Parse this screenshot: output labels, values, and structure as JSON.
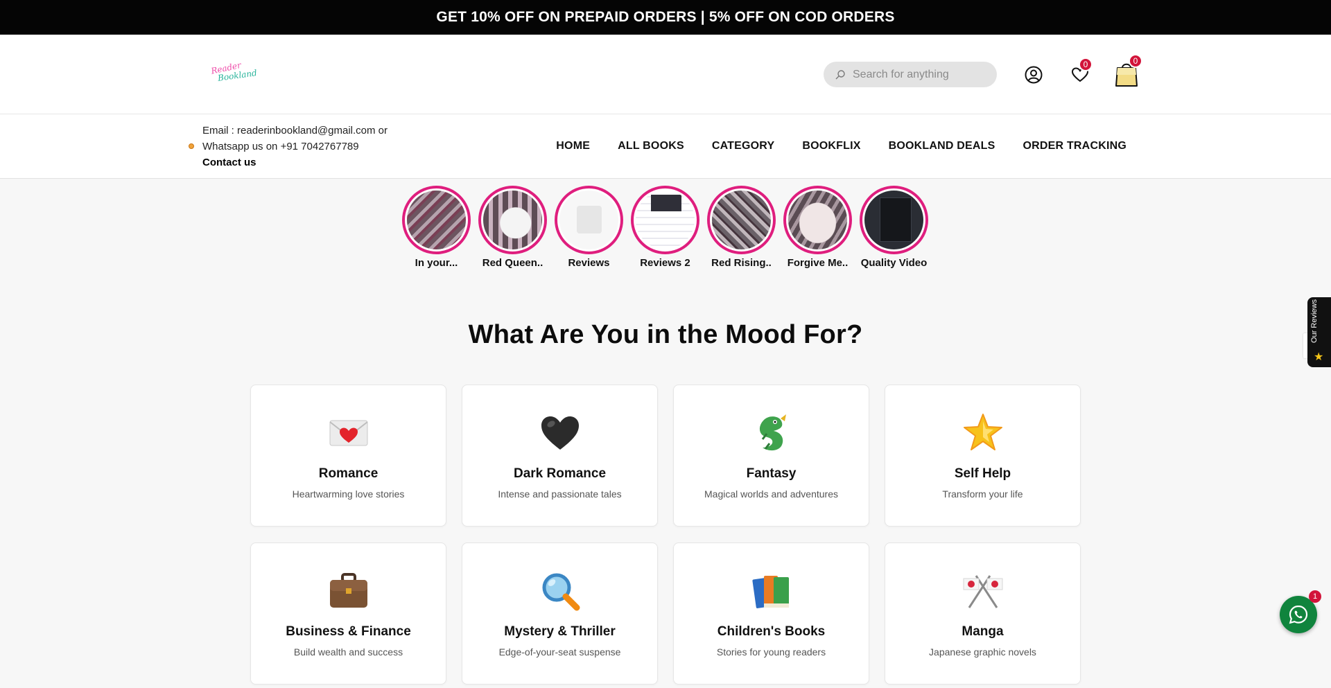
{
  "announcement": "GET 10% OFF ON PREPAID ORDERS | 5% OFF ON COD ORDERS",
  "logo": {
    "line1": "Reader",
    "line2": "Bookland"
  },
  "search": {
    "placeholder": "Search for anything",
    "icon": "search-icon"
  },
  "header_icons": {
    "account": "user-icon",
    "wishlist_count": "0",
    "cart_count": "0"
  },
  "contact": {
    "email_line": "Email : readerinbookland@gmail.com or",
    "whatsapp_line": "Whatsapp us on +91 7042767789",
    "cta": "Contact us"
  },
  "nav": [
    "HOME",
    "ALL BOOKS",
    "CATEGORY",
    "BOOKFLIX",
    "BOOKLAND DEALS",
    "ORDER TRACKING"
  ],
  "stories": [
    "In your...",
    "Red Queen..",
    "Reviews",
    "Reviews 2",
    "Red Rising..",
    "Forgive Me..",
    "Quality Video"
  ],
  "section_title": "What Are You in the Mood For?",
  "moods": [
    {
      "name": "Romance",
      "desc": "Heartwarming love stories",
      "icon": "love-letter-icon"
    },
    {
      "name": "Dark Romance",
      "desc": "Intense and passionate tales",
      "icon": "black-heart-icon"
    },
    {
      "name": "Fantasy",
      "desc": "Magical worlds and adventures",
      "icon": "dragon-icon"
    },
    {
      "name": "Self Help",
      "desc": "Transform your life",
      "icon": "glowing-star-icon"
    },
    {
      "name": "Business & Finance",
      "desc": "Build wealth and success",
      "icon": "briefcase-icon"
    },
    {
      "name": "Mystery & Thriller",
      "desc": "Edge-of-your-seat suspense",
      "icon": "magnifying-glass-icon"
    },
    {
      "name": "Children's Books",
      "desc": "Stories for young readers",
      "icon": "books-icon"
    },
    {
      "name": "Manga",
      "desc": "Japanese graphic novels",
      "icon": "crossed-flags-icon"
    }
  ],
  "reviews_tab": "Our Reviews",
  "whatsapp_badge": "1",
  "colors": {
    "accent": "#d2143a",
    "story_ring": "#df1e7e",
    "whatsapp": "#10843d",
    "announcement_bg": "#050505"
  }
}
